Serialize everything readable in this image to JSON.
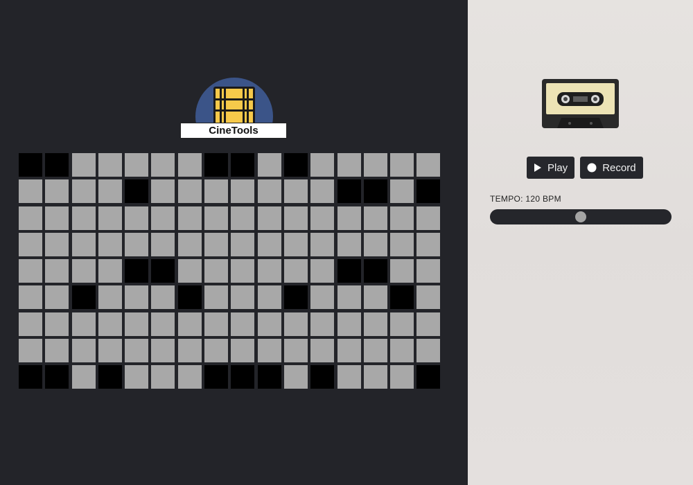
{
  "app": {
    "logo_text": "CineTools"
  },
  "colors": {
    "left_bg": "#232429",
    "right_bg": "#e3dfdd",
    "cell_off": "#a8a8a8",
    "cell_on": "#000000",
    "button_bg": "#26272c",
    "logo_dome": "#3b5488",
    "logo_film": "#f6c94a"
  },
  "sequencer": {
    "columns": 16,
    "rows": [
      [
        1,
        1,
        0,
        0,
        0,
        0,
        0,
        1,
        1,
        0,
        1,
        0,
        0,
        0,
        0,
        0
      ],
      [
        0,
        0,
        0,
        0,
        1,
        0,
        0,
        0,
        0,
        0,
        0,
        0,
        1,
        1,
        0,
        1
      ],
      [
        0,
        0,
        0,
        0,
        0,
        0,
        0,
        0,
        0,
        0,
        0,
        0,
        0,
        0,
        0,
        0
      ],
      [
        0,
        0,
        0,
        0,
        0,
        0,
        0,
        0,
        0,
        0,
        0,
        0,
        0,
        0,
        0,
        0
      ],
      [
        0,
        0,
        0,
        0,
        1,
        1,
        0,
        0,
        0,
        0,
        0,
        0,
        1,
        1,
        0,
        0
      ],
      [
        0,
        0,
        1,
        0,
        0,
        0,
        1,
        0,
        0,
        0,
        1,
        0,
        0,
        0,
        1,
        0
      ],
      [
        0,
        0,
        0,
        0,
        0,
        0,
        0,
        0,
        0,
        0,
        0,
        0,
        0,
        0,
        0,
        0
      ],
      [
        0,
        0,
        0,
        0,
        0,
        0,
        0,
        0,
        0,
        0,
        0,
        0,
        0,
        0,
        0,
        0
      ],
      [
        1,
        1,
        0,
        1,
        0,
        0,
        0,
        1,
        1,
        1,
        0,
        1,
        0,
        0,
        0,
        1
      ]
    ]
  },
  "transport": {
    "play_label": "Play",
    "record_label": "Record",
    "play_icon": "play-icon",
    "record_icon": "record-icon"
  },
  "tempo": {
    "label": "TEMPO: 120 BPM",
    "value_fraction": 0.5
  }
}
